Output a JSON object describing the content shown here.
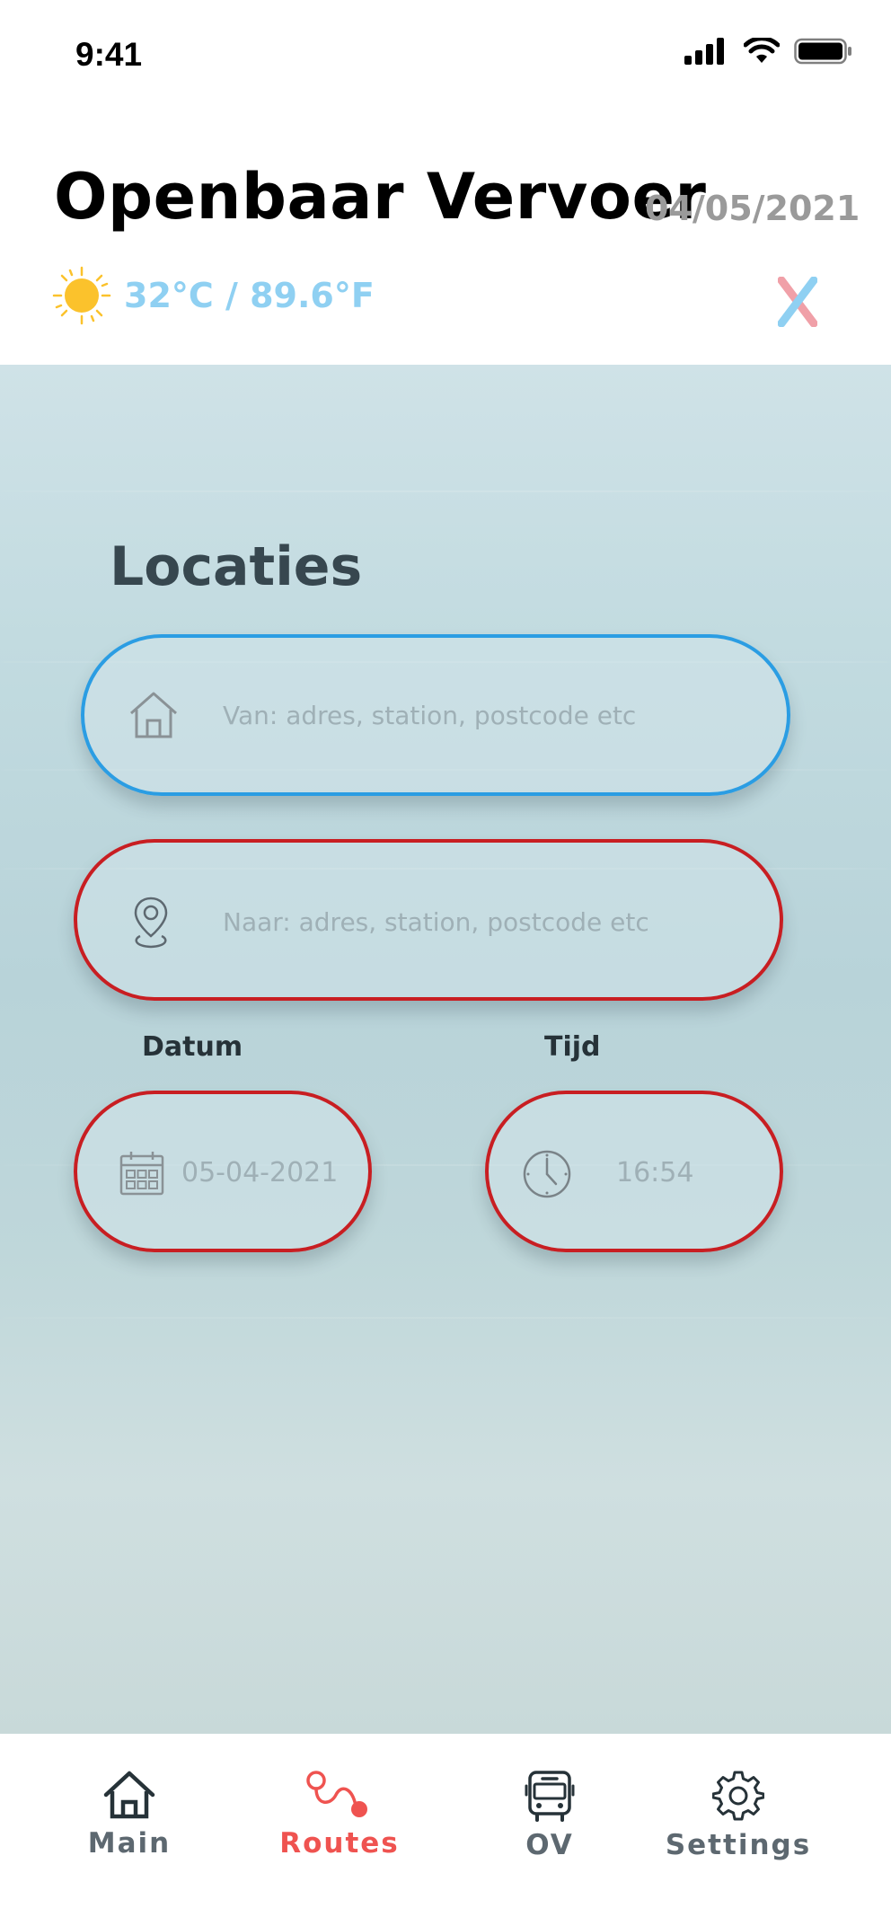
{
  "status_bar": {
    "time": "9:41"
  },
  "header": {
    "title": "Openbaar Vervoer",
    "date": "04/05/2021",
    "weather": "32°C / 89.6°F"
  },
  "locaties": {
    "title": "Locaties",
    "from_placeholder": "Van: adres, station, postcode etc",
    "to_placeholder": "Naar: adres, station, postcode etc",
    "datum_label": "Datum",
    "tijd_label": "Tijd",
    "datum_value": "05-04-2021",
    "tijd_value": "16:54"
  },
  "tabs": [
    {
      "label": "Main",
      "icon": "home-icon"
    },
    {
      "label": "Routes",
      "icon": "route-icon"
    },
    {
      "label": "OV",
      "icon": "bus-icon"
    },
    {
      "label": "Settings",
      "icon": "gear-icon"
    }
  ],
  "colors": {
    "from_border": "#2b9de3",
    "to_border": "#c81e22",
    "active_tab": "#ef5350",
    "weather_text": "#8fd0f2"
  }
}
